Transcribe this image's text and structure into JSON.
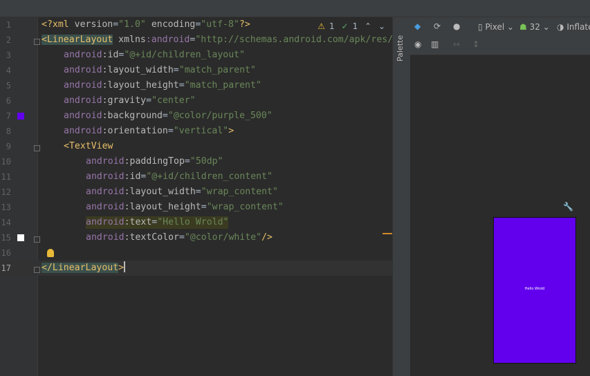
{
  "editor": {
    "lines": [
      {
        "num": "1"
      },
      {
        "num": "2"
      },
      {
        "num": "3"
      },
      {
        "num": "4"
      },
      {
        "num": "5"
      },
      {
        "num": "6"
      },
      {
        "num": "7"
      },
      {
        "num": "8"
      },
      {
        "num": "9"
      },
      {
        "num": "10"
      },
      {
        "num": "11"
      },
      {
        "num": "12"
      },
      {
        "num": "13"
      },
      {
        "num": "14"
      },
      {
        "num": "15"
      },
      {
        "num": "16"
      },
      {
        "num": "17"
      }
    ],
    "code": {
      "l1": {
        "a": "<?xml ",
        "b": "version",
        "c": "=",
        "d": "\"1.0\"",
        "e": " encoding",
        "f": "=",
        "g": "\"utf-8\"",
        "h": "?>"
      },
      "l2": {
        "tag": "<LinearLayout",
        "attr": " xmlns",
        "ns": ":android",
        "eq": "=",
        "str": "\"http://schemas.android.com/apk/res/"
      },
      "l3": {
        "ns": "android",
        "attr": ":id",
        "eq": "=",
        "str": "\"@+id/children_layout\""
      },
      "l4": {
        "ns": "android",
        "attr": ":layout_width",
        "eq": "=",
        "str": "\"match_parent\""
      },
      "l5": {
        "ns": "android",
        "attr": ":layout_height",
        "eq": "=",
        "str": "\"match_parent\""
      },
      "l6": {
        "ns": "android",
        "attr": ":gravity",
        "eq": "=",
        "str": "\"center\""
      },
      "l7": {
        "ns": "android",
        "attr": ":background",
        "eq": "=",
        "str": "\"@color/purple_500\""
      },
      "l8": {
        "ns": "android",
        "attr": ":orientation",
        "eq": "=",
        "str": "\"vertical\"",
        "end": ">"
      },
      "l9": {
        "tag": "<TextView"
      },
      "l10": {
        "ns": "android",
        "attr": ":paddingTop",
        "eq": "=",
        "str": "\"50dp\""
      },
      "l11": {
        "ns": "android",
        "attr": ":id",
        "eq": "=",
        "str": "\"@+id/children_content\""
      },
      "l12": {
        "ns": "android",
        "attr": ":layout_width",
        "eq": "=",
        "str": "\"wrap_content\""
      },
      "l13": {
        "ns": "android",
        "attr": ":layout_height",
        "eq": "=",
        "str": "\"wrap_content\""
      },
      "l14": {
        "ns": "android",
        "attr": ":text",
        "eq": "=",
        "str": "\"Hello Wrold\""
      },
      "l15": {
        "ns": "android",
        "attr": ":textColor",
        "eq": "=",
        "str": "\"@color/white\"",
        "end": "/>"
      },
      "l17": {
        "tag": "</LinearLayout",
        "end": ">"
      }
    },
    "inspections": {
      "warnings": "1",
      "typos": "1"
    },
    "swatch_colors": {
      "line7": "#6200ee",
      "line15": "#ffffff"
    }
  },
  "palette": {
    "label": "Palette"
  },
  "design": {
    "device": "Pixel",
    "api": "32",
    "inflate": "Inflate",
    "preview_bg": "#6200ee",
    "preview_text": "Hello Wrold"
  }
}
